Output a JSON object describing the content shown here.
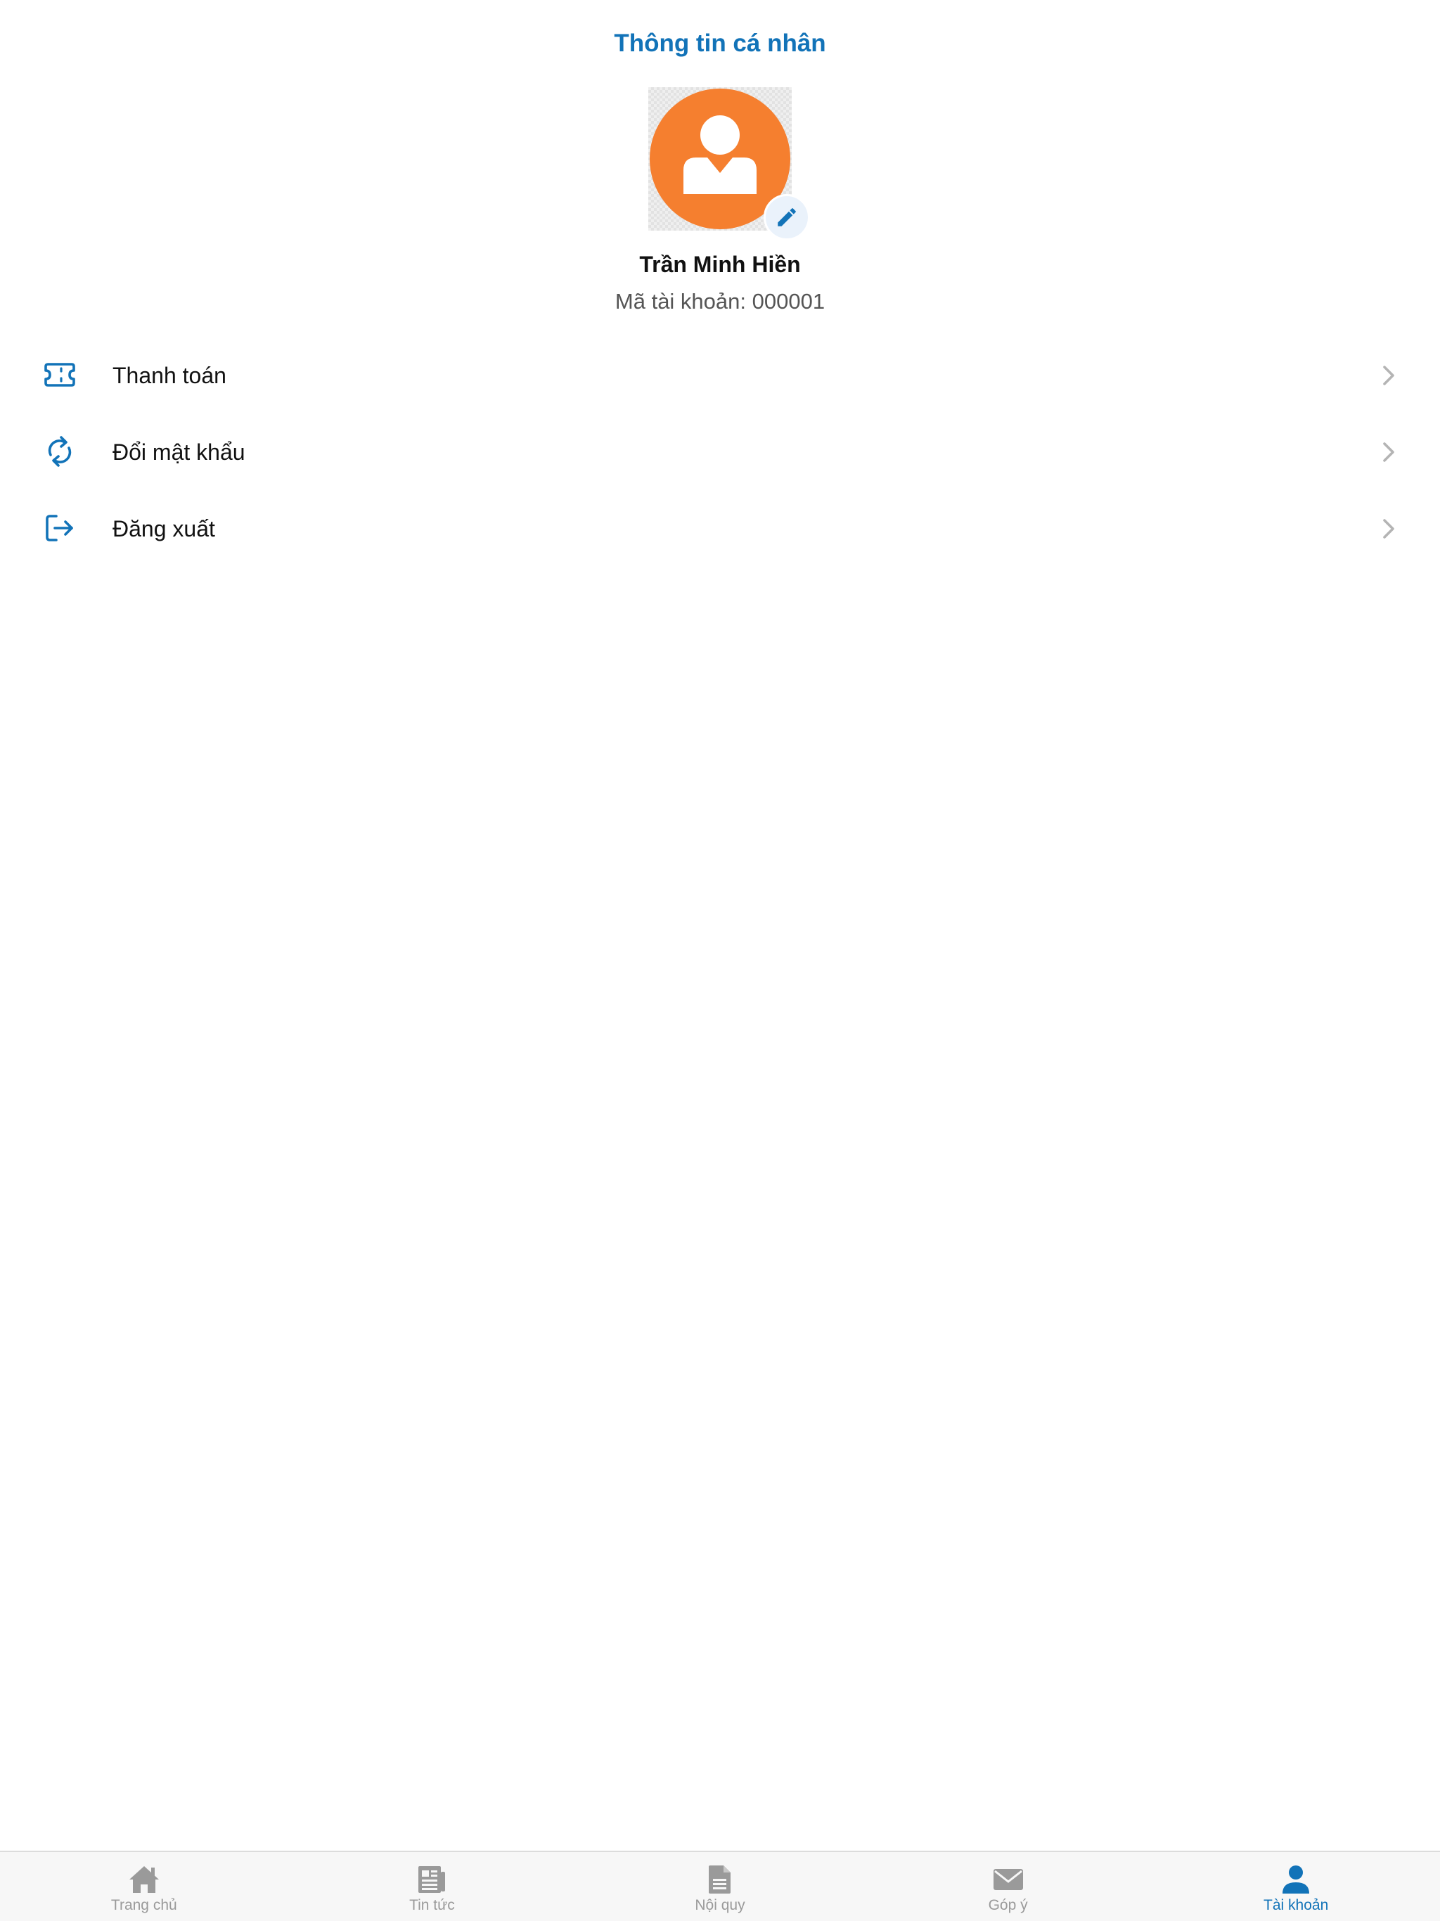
{
  "header": {
    "title": "Thông tin cá nhân"
  },
  "profile": {
    "name": "Trần Minh Hiền",
    "account_code": "Mã tài khoản: 000001",
    "avatar_icon": "user-avatar-icon",
    "edit_icon": "pencil-icon"
  },
  "menu": {
    "items": [
      {
        "label": "Thanh toán",
        "icon": "ticket-icon"
      },
      {
        "label": "Đổi mật khẩu",
        "icon": "refresh-icon"
      },
      {
        "label": "Đăng xuất",
        "icon": "logout-icon"
      }
    ],
    "chevron_icon": "chevron-right-icon"
  },
  "tabbar": {
    "tabs": [
      {
        "label": "Trang chủ",
        "icon": "home-icon",
        "active": false
      },
      {
        "label": "Tin tức",
        "icon": "newspaper-icon",
        "active": false
      },
      {
        "label": "Nội quy",
        "icon": "document-icon",
        "active": false
      },
      {
        "label": "Góp ý",
        "icon": "mail-icon",
        "active": false
      },
      {
        "label": "Tài khoản",
        "icon": "user-icon",
        "active": true
      }
    ]
  },
  "colors": {
    "accent": "#1273b8",
    "avatar": "#f57f2f",
    "inactive": "#9a9a9a",
    "chevron": "#b4b4b4"
  }
}
